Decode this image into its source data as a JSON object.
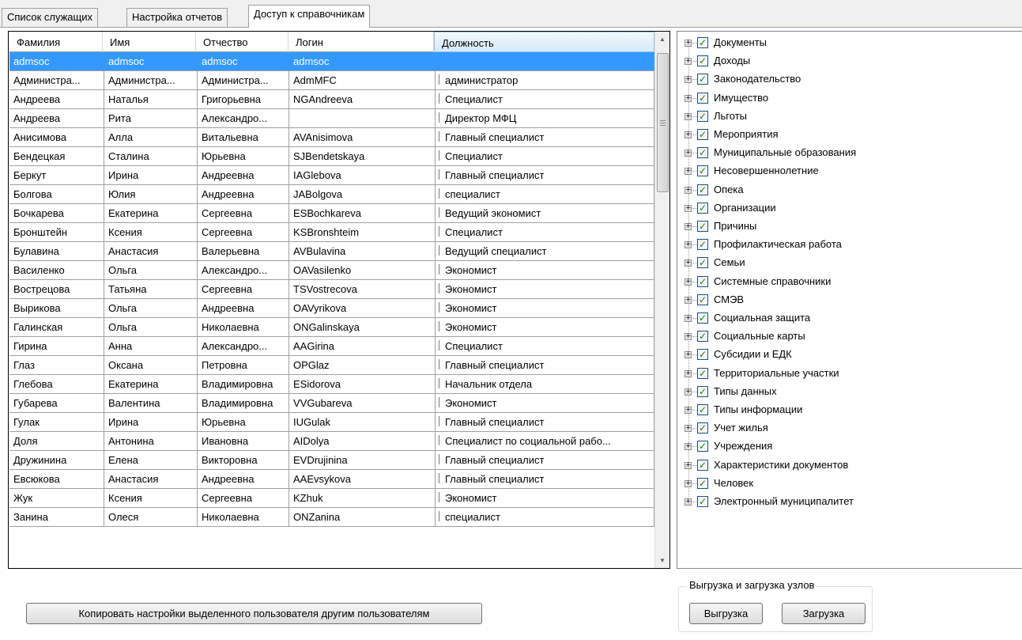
{
  "tabs": [
    {
      "label": "Список служащих"
    },
    {
      "label": "Настройка отчетов"
    },
    {
      "label": "Доступ к справочникам"
    }
  ],
  "grid": {
    "columns": [
      "Фамилия",
      "Имя",
      "Отчество",
      "Логин",
      "Должность"
    ],
    "rows": [
      [
        "admsoc",
        "admsoc",
        "admsoc",
        "admsoc",
        ""
      ],
      [
        "Администра...",
        "Администра...",
        "Администра...",
        "AdmMFC",
        "администратор"
      ],
      [
        "Андреева",
        "Наталья",
        "Григорьевна",
        "NGAndreeva",
        "Специалист"
      ],
      [
        "Андреева",
        "Рита",
        "Александро...",
        "",
        "Директор МФЦ"
      ],
      [
        "Анисимова",
        "Алла",
        "Витальевна",
        "AVAnisimova",
        "Главный специалист"
      ],
      [
        "Бендецкая",
        "Сталина",
        "Юрьевна",
        "SJBendetskaya",
        "Специалист"
      ],
      [
        "Беркут",
        "Ирина",
        "Андреевна",
        "IAGlebova",
        "Главный специалист"
      ],
      [
        "Болгова",
        "Юлия",
        "Андреевна",
        "JABolgova",
        "специалист"
      ],
      [
        "Бочкарева",
        "Екатерина",
        "Сергеевна",
        "ESBochkareva",
        "Ведущий экономист"
      ],
      [
        "Бронштейн",
        "Ксения",
        "Сергеевна",
        "KSBronshteim",
        "Специалист"
      ],
      [
        "Булавина",
        "Анастасия",
        "Валерьевна",
        "AVBulavina",
        "Ведущий специалист"
      ],
      [
        "Василенко",
        "Ольга",
        "Александро...",
        "OAVasilenko",
        "Экономист"
      ],
      [
        "Вострецова",
        "Татьяна",
        "Сергеевна",
        "TSVostrecova",
        "Экономист"
      ],
      [
        "Вырикова",
        "Ольга",
        "Андреевна",
        "OAVyrikova",
        "Экономист"
      ],
      [
        "Галинская",
        "Ольга",
        "Николаевна",
        "ONGalinskaya",
        "Экономист"
      ],
      [
        "Гирина",
        "Анна",
        "Александро...",
        "AAGirina",
        "Специалист"
      ],
      [
        "Глаз",
        "Оксана",
        "Петровна",
        "OPGlaz",
        "Главный специалист"
      ],
      [
        "Глебова",
        "Екатерина",
        "Владимировна",
        "ESidorova",
        "Начальник отдела"
      ],
      [
        "Губарева",
        "Валентина",
        "Владимировна",
        "VVGubareva",
        "Экономист"
      ],
      [
        "Гулак",
        "Ирина",
        "Юрьевна",
        "IUGulak",
        "Главный специалист"
      ],
      [
        "Доля",
        "Антонина",
        "Ивановна",
        "AIDolya",
        "Специалист по социальной рабо..."
      ],
      [
        "Дружинина",
        "Елена",
        "Викторовна",
        "EVDrujinina",
        "Главный специалист"
      ],
      [
        "Евсюкова",
        "Анастасия",
        "Андреевна",
        "AAEvsykova",
        "Главный специалист"
      ],
      [
        "Жук",
        "Ксения",
        "Сергеевна",
        "KZhuk",
        "Экономист"
      ],
      [
        "Занина",
        "Олеся",
        "Николаевна",
        "ONZanina",
        "специалист"
      ]
    ]
  },
  "scrollbar": {
    "up_glyph": "▲",
    "down_glyph": "▼"
  },
  "tree": {
    "items": [
      "Документы",
      "Доходы",
      "Законодательство",
      "Имущество",
      "Льготы",
      "Мероприятия",
      "Муниципальные образования",
      "Несовершеннолетние",
      "Опека",
      "Организации",
      "Причины",
      "Профилактическая работа",
      "Семьи",
      "Системные справочники",
      "СМЭВ",
      "Социальная защита",
      "Социальные карты",
      "Субсидии и ЕДК",
      "Территориальные участки",
      "Типы данных",
      "Типы информации",
      "Учет жилья",
      "Учреждения",
      "Характеристики документов",
      "Человек",
      "Электронный муниципалитет"
    ],
    "expander_glyph": "+",
    "check_glyph": "✓"
  },
  "copy_button": "Копировать настройки выделенного пользователя другим пользователям",
  "nodes_group": {
    "title": "Выгрузка и загрузка узлов",
    "export_label": "Выгрузка",
    "import_label": "Загрузка"
  }
}
